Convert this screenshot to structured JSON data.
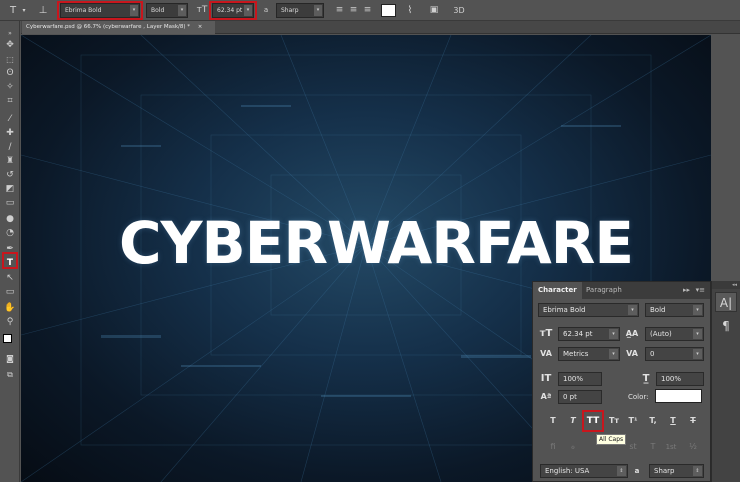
{
  "options_bar": {
    "font_family": "Ebrima Bold",
    "font_style": "Bold",
    "font_size": "62.34 pt",
    "antialias_prefix": "a",
    "antialias": "Sharp"
  },
  "document_tab": {
    "title": "Cyberwarfare.psd @ 66.7% (cyberwarfare , Layer Mask/8) *",
    "close_glyph": "×"
  },
  "canvas": {
    "headline": "CYBERWARFARE"
  },
  "character_panel": {
    "tabs": [
      "Character",
      "Paragraph"
    ],
    "active_tab": "Character",
    "font_family": "Ebrima Bold",
    "font_style": "Bold",
    "font_size": "62.34 pt",
    "leading": "(Auto)",
    "kerning": "Metrics",
    "tracking": "0",
    "vertical_scale": "100%",
    "horizontal_scale": "100%",
    "baseline_shift": "0 pt",
    "color_label": "Color:",
    "color_value": "#ffffff",
    "style_buttons": [
      "T",
      "T",
      "TT",
      "Tт",
      "T¹",
      "T,",
      "T",
      "T"
    ],
    "opentype_buttons": [
      "fi",
      "ℴ",
      "st",
      "A",
      "ad",
      "T",
      "1st",
      "½"
    ],
    "language": "English: USA",
    "antialias": "Sharp",
    "tooltip": "All Caps"
  },
  "colors": {
    "highlight_red": "#c8161d",
    "canvas_dark": "#0b1827",
    "panel_bg": "#535353"
  },
  "icons": {
    "tools": [
      "move-icon",
      "marquee-icon",
      "lasso-icon",
      "magic-wand-icon",
      "crop-icon",
      "eyedropper-icon",
      "healing-brush-icon",
      "brush-icon",
      "clone-stamp-icon",
      "history-brush-icon",
      "eraser-icon",
      "gradient-icon",
      "blur-icon",
      "dodge-icon",
      "pen-icon",
      "type-icon",
      "path-selection-icon",
      "rectangle-shape-icon",
      "hand-icon",
      "zoom-icon"
    ]
  }
}
